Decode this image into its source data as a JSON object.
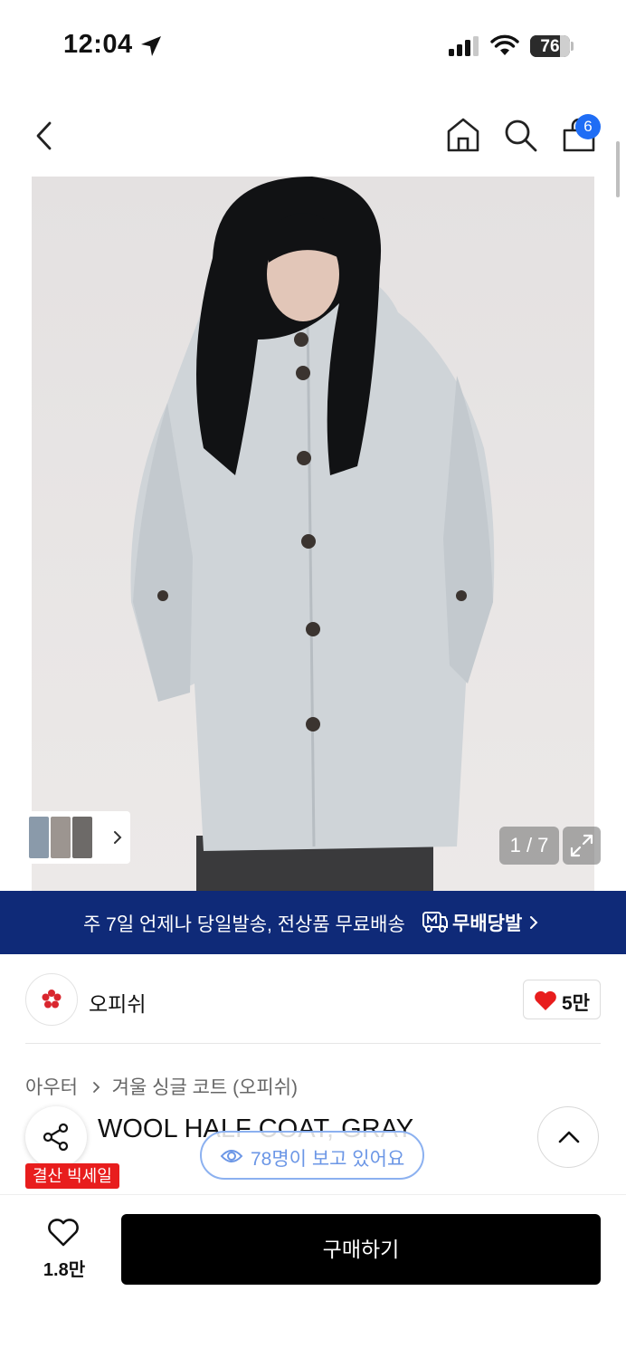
{
  "status_bar": {
    "time": "12:04",
    "battery": "76",
    "battery_level": 0.76
  },
  "nav": {
    "cart_count": "6",
    "icons": [
      "back-chevron-icon",
      "home-icon",
      "search-icon",
      "shopping-bag-icon"
    ]
  },
  "gallery": {
    "counter": "1 / 7",
    "thumbnails": 3
  },
  "banner": {
    "text": "주 7일 언제나 당일발송, 전상품 무료배송",
    "brand_text": "무배당발",
    "color": "#0f2a78"
  },
  "brand": {
    "name": "오피쉬",
    "likes": "5만"
  },
  "breadcrumb": {
    "category": "아우터",
    "subcategory": "겨울 싱글 코트 (오피쉬)"
  },
  "product": {
    "title_visible": "WOOL HALF COAT, GRAY",
    "sale_badge": "결산 빅세일",
    "sale_color": "#e81d1d"
  },
  "viewers": {
    "text": "78명이 보고 있어요"
  },
  "bottom_bar": {
    "wish_count": "1.8만",
    "buy_label": "구매하기"
  }
}
